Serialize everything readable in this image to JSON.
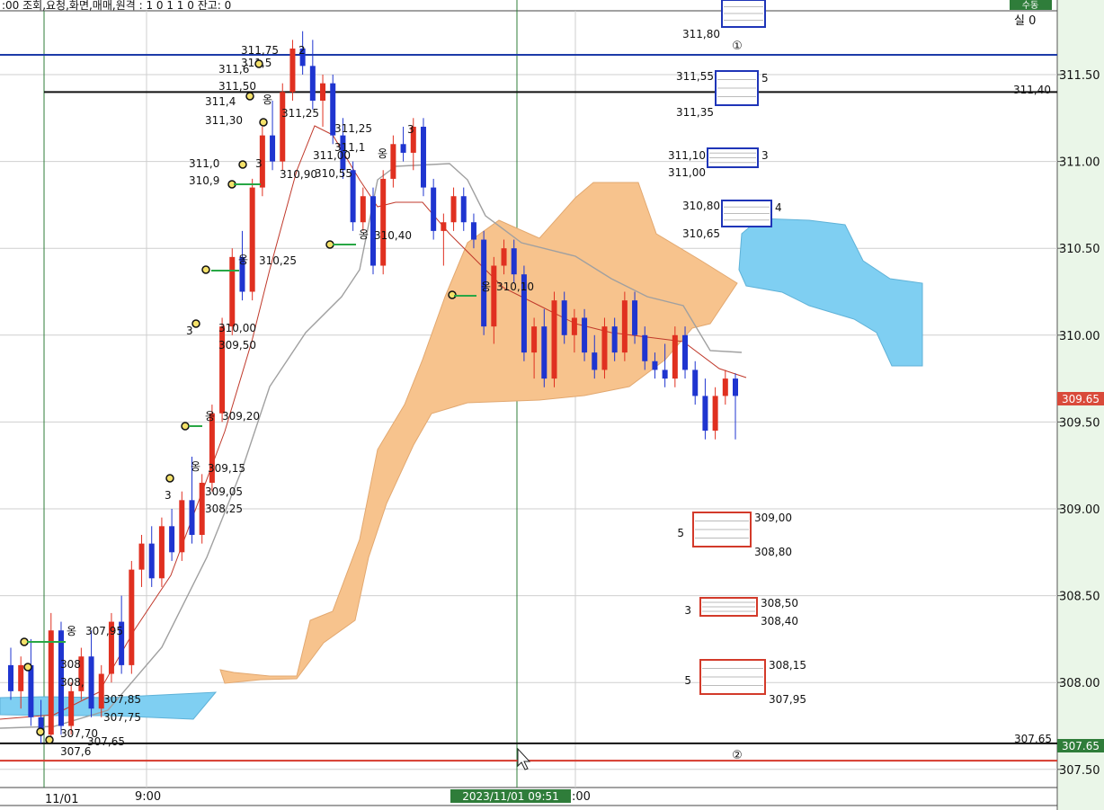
{
  "header": {
    "info_text": ":00 조회,요청,화면,매매,원격 : 1 0 1 1 0 잔고: 0",
    "mode_badge": "수동",
    "status_text": "실 0"
  },
  "axis": {
    "y_ticks": [
      "311.50",
      "311.00",
      "310.50",
      "310.00",
      "309.50",
      "309.00",
      "308.50",
      "308.00",
      "307.50"
    ],
    "x_labels": [
      "11/01",
      "9:00",
      ":00"
    ],
    "crosshair_time": "2023/11/01 09:51",
    "current_price": "309.65",
    "line_price_tag": "307.65"
  },
  "colors": {
    "up": "#e03020",
    "down": "#1f35d0",
    "cloud_bull": "#f7c38d",
    "cloud_bear": "#7fcff2",
    "grid": "#cfcfcf",
    "hline_blue": "#1d3aa8",
    "hline_red": "#d63a2c",
    "price_tag": "#d94a3a",
    "badge_green": "#2f7d3a"
  },
  "hlines": {
    "blue_label": "",
    "black_label": "311,40",
    "bottom_black_label": "307,65"
  },
  "markers": {
    "circle_1": "①",
    "circle_2": "②"
  },
  "order_boxes": [
    {
      "side": "sell",
      "top": "311,80",
      "bottom": "",
      "qty": ""
    },
    {
      "side": "sell",
      "top": "311,55",
      "bottom": "311,35",
      "qty": "5"
    },
    {
      "side": "sell",
      "top": "311,10",
      "bottom": "311,00",
      "qty": "3"
    },
    {
      "side": "sell",
      "top": "310,80",
      "bottom": "310,65",
      "qty": "4"
    },
    {
      "side": "buy",
      "top": "309,00",
      "bottom": "308,80",
      "qty": "5"
    },
    {
      "side": "buy",
      "top": "308,50",
      "bottom": "308,40",
      "qty": "3"
    },
    {
      "side": "buy",
      "top": "308,15",
      "bottom": "307,95",
      "qty": "5"
    }
  ],
  "chart_data": {
    "type": "candlestick",
    "title": "",
    "ylim": [
      307.42,
      311.95
    ],
    "grid": true,
    "candles": [
      [
        308.1,
        308.2,
        307.9,
        307.95
      ],
      [
        307.95,
        308.15,
        307.85,
        308.1
      ],
      [
        308.1,
        308.25,
        307.75,
        307.8
      ],
      [
        307.8,
        307.9,
        307.65,
        307.7
      ],
      [
        307.7,
        308.4,
        307.65,
        308.3
      ],
      [
        308.3,
        308.35,
        307.7,
        307.75
      ],
      [
        307.75,
        308.0,
        307.7,
        307.95
      ],
      [
        307.95,
        308.2,
        307.9,
        308.15
      ],
      [
        308.15,
        308.3,
        307.8,
        307.85
      ],
      [
        307.85,
        308.1,
        307.8,
        308.05
      ],
      [
        308.05,
        308.4,
        308.0,
        308.35
      ],
      [
        308.35,
        308.5,
        308.05,
        308.1
      ],
      [
        308.1,
        308.7,
        308.05,
        308.65
      ],
      [
        308.65,
        308.85,
        308.55,
        308.8
      ],
      [
        308.8,
        308.9,
        308.55,
        308.6
      ],
      [
        308.6,
        308.95,
        308.55,
        308.9
      ],
      [
        308.9,
        309.0,
        308.7,
        308.75
      ],
      [
        308.75,
        309.1,
        308.7,
        309.05
      ],
      [
        309.05,
        309.3,
        308.8,
        308.85
      ],
      [
        308.85,
        309.2,
        308.8,
        309.15
      ],
      [
        309.15,
        309.6,
        309.1,
        309.55
      ],
      [
        309.55,
        310.1,
        309.5,
        310.05
      ],
      [
        310.05,
        310.5,
        310.0,
        310.45
      ],
      [
        310.45,
        310.6,
        310.2,
        310.25
      ],
      [
        310.25,
        310.9,
        310.2,
        310.85
      ],
      [
        310.85,
        311.2,
        310.8,
        311.15
      ],
      [
        311.15,
        311.35,
        310.95,
        311.0
      ],
      [
        311.0,
        311.45,
        310.95,
        311.4
      ],
      [
        311.4,
        311.7,
        311.35,
        311.65
      ],
      [
        311.65,
        311.75,
        311.5,
        311.55
      ],
      [
        311.55,
        311.7,
        311.3,
        311.35
      ],
      [
        311.35,
        311.5,
        311.2,
        311.45
      ],
      [
        311.45,
        311.5,
        311.1,
        311.15
      ],
      [
        311.15,
        311.25,
        310.9,
        310.95
      ],
      [
        310.95,
        311.0,
        310.6,
        310.65
      ],
      [
        310.65,
        310.85,
        310.6,
        310.8
      ],
      [
        310.8,
        310.85,
        310.35,
        310.4
      ],
      [
        310.4,
        310.95,
        310.35,
        310.9
      ],
      [
        310.9,
        311.15,
        310.85,
        311.1
      ],
      [
        311.1,
        311.2,
        311.0,
        311.05
      ],
      [
        311.05,
        311.25,
        310.95,
        311.2
      ],
      [
        311.2,
        311.25,
        310.8,
        310.85
      ],
      [
        310.85,
        310.9,
        310.55,
        310.6
      ],
      [
        310.6,
        310.7,
        310.4,
        310.65
      ],
      [
        310.65,
        310.85,
        310.6,
        310.8
      ],
      [
        310.8,
        310.85,
        310.6,
        310.65
      ],
      [
        310.65,
        310.7,
        310.5,
        310.55
      ],
      [
        310.55,
        310.6,
        310.0,
        310.05
      ],
      [
        310.05,
        310.45,
        309.95,
        310.4
      ],
      [
        310.4,
        310.55,
        310.35,
        310.5
      ],
      [
        310.5,
        310.55,
        310.3,
        310.35
      ],
      [
        310.35,
        310.4,
        309.85,
        309.9
      ],
      [
        309.9,
        310.1,
        309.75,
        310.05
      ],
      [
        310.05,
        310.15,
        309.7,
        309.75
      ],
      [
        309.75,
        310.25,
        309.7,
        310.2
      ],
      [
        310.2,
        310.25,
        309.95,
        310.0
      ],
      [
        310.0,
        310.15,
        309.9,
        310.1
      ],
      [
        310.1,
        310.15,
        309.85,
        309.9
      ],
      [
        309.9,
        310.0,
        309.75,
        309.8
      ],
      [
        309.8,
        310.1,
        309.75,
        310.05
      ],
      [
        310.05,
        310.1,
        309.85,
        309.9
      ],
      [
        309.9,
        310.25,
        309.85,
        310.2
      ],
      [
        310.2,
        310.25,
        309.95,
        310.0
      ],
      [
        310.0,
        310.05,
        309.8,
        309.85
      ],
      [
        309.85,
        309.9,
        309.75,
        309.8
      ],
      [
        309.8,
        309.95,
        309.7,
        309.75
      ],
      [
        309.75,
        310.05,
        309.7,
        310.0
      ],
      [
        310.0,
        310.05,
        309.75,
        309.8
      ],
      [
        309.8,
        309.85,
        309.6,
        309.65
      ],
      [
        309.65,
        309.75,
        309.4,
        309.45
      ],
      [
        309.45,
        309.7,
        309.4,
        309.65
      ],
      [
        309.65,
        309.8,
        309.6,
        309.75
      ],
      [
        309.75,
        309.78,
        309.4,
        309.65
      ]
    ],
    "ichimoku": {
      "span_a_b_shaded": true,
      "labels": [
        "310,40",
        "310,25",
        "309,50",
        "309,20",
        "310,55",
        "310,90"
      ]
    },
    "price_labels": [
      "311,75",
      "311,6",
      "311,5",
      "311,50",
      "311,4",
      "311,30",
      "311,25",
      "311,0",
      "310,9",
      "310,90",
      "311,25",
      "311,1",
      "311,00",
      "310,55",
      "310,40",
      "310,25",
      "310,10",
      "310,00",
      "309,50",
      "309,20",
      "309,15",
      "309,05",
      "308,25",
      "307,95",
      "307,85",
      "307,75",
      "307,70",
      "307,65",
      "307,6",
      "308",
      "308,"
    ],
    "annotations": [
      "2",
      "3",
      "3",
      "3",
      "3",
      "옹",
      "옹",
      "옹",
      "옹",
      "옹",
      "옹",
      "옹",
      "옹"
    ]
  }
}
